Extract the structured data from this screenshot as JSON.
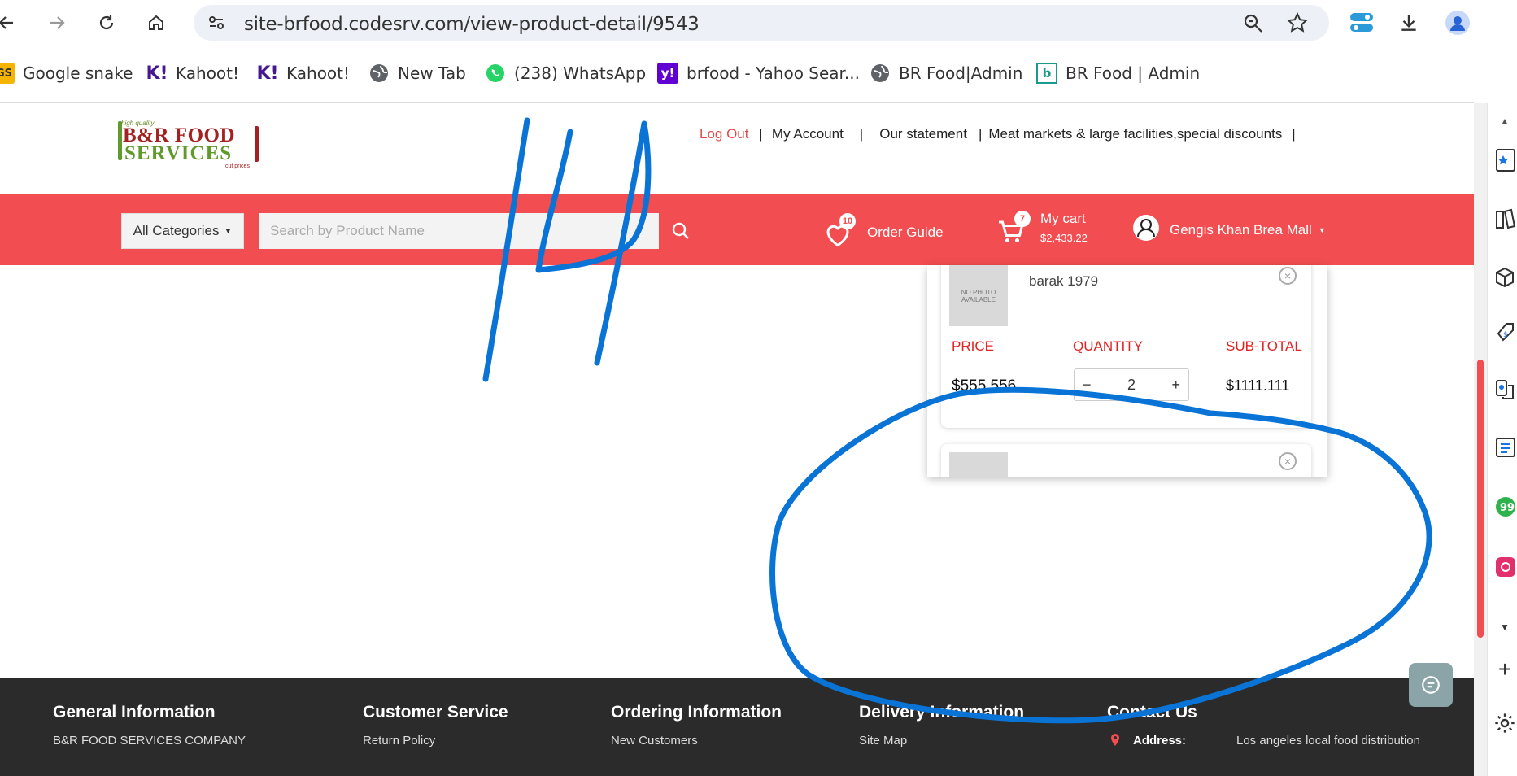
{
  "browser": {
    "url": "site-brfood.codesrv.com/view-product-detail/9543",
    "bookmarks": [
      {
        "label": "Google snake",
        "icon": "gs-icon"
      },
      {
        "label": "Kahoot!",
        "icon": "kahoot-icon"
      },
      {
        "label": "Kahoot!",
        "icon": "kahoot-icon"
      },
      {
        "label": "New Tab",
        "icon": "globe-icon"
      },
      {
        "label": "(238) WhatsApp",
        "icon": "whatsapp-icon"
      },
      {
        "label": "brfood - Yahoo Sear...",
        "icon": "yahoo-icon"
      },
      {
        "label": "BR Food|Admin",
        "icon": "globe-icon"
      },
      {
        "label": "BR Food | Admin",
        "icon": "b-icon"
      }
    ]
  },
  "header": {
    "logo": {
      "tagline": "high quality",
      "line1": "B&R FOOD",
      "line2": "SERVICES",
      "sub": "cut prices"
    },
    "top_links": {
      "logout": "Log Out",
      "my_account": "My Account",
      "statement": "Our statement",
      "meat_markets": "Meat markets & large facilities,special discounts",
      "separator": "|"
    },
    "categories_label": "All Categories",
    "search_placeholder": "Search by Product Name",
    "order_guide": {
      "label": "Order Guide",
      "count": "10"
    },
    "cart": {
      "label": "My cart",
      "count": "7",
      "total": "$2,433.22"
    },
    "user": {
      "name": "Gengis Khan Brea Mall"
    }
  },
  "cart_dropdown": {
    "item": {
      "image_text": "NO PHOTO AVAILABLE",
      "name": "barak 1979",
      "price_header": "PRICE",
      "quantity_header": "QUANTITY",
      "subtotal_header": "SUB-TOTAL",
      "price": "$555.556",
      "quantity": "2",
      "minus": "−",
      "plus": "+",
      "subtotal": "$1111.111"
    }
  },
  "footer": {
    "columns": [
      {
        "heading": "General Information",
        "first_link": "B&R FOOD SERVICES COMPANY"
      },
      {
        "heading": "Customer Service",
        "first_link": "Return Policy"
      },
      {
        "heading": "Ordering Information",
        "first_link": "New Customers"
      },
      {
        "heading": "Delivery Information",
        "first_link": "Site Map"
      },
      {
        "heading": "Contact Us",
        "address_label": "Address:",
        "address_value": "Los angeles local food distribution"
      }
    ]
  },
  "colors": {
    "brand_red": "#f24d50",
    "annotation_blue": "#0a74d6",
    "footer_bg": "#2b2b2b"
  }
}
